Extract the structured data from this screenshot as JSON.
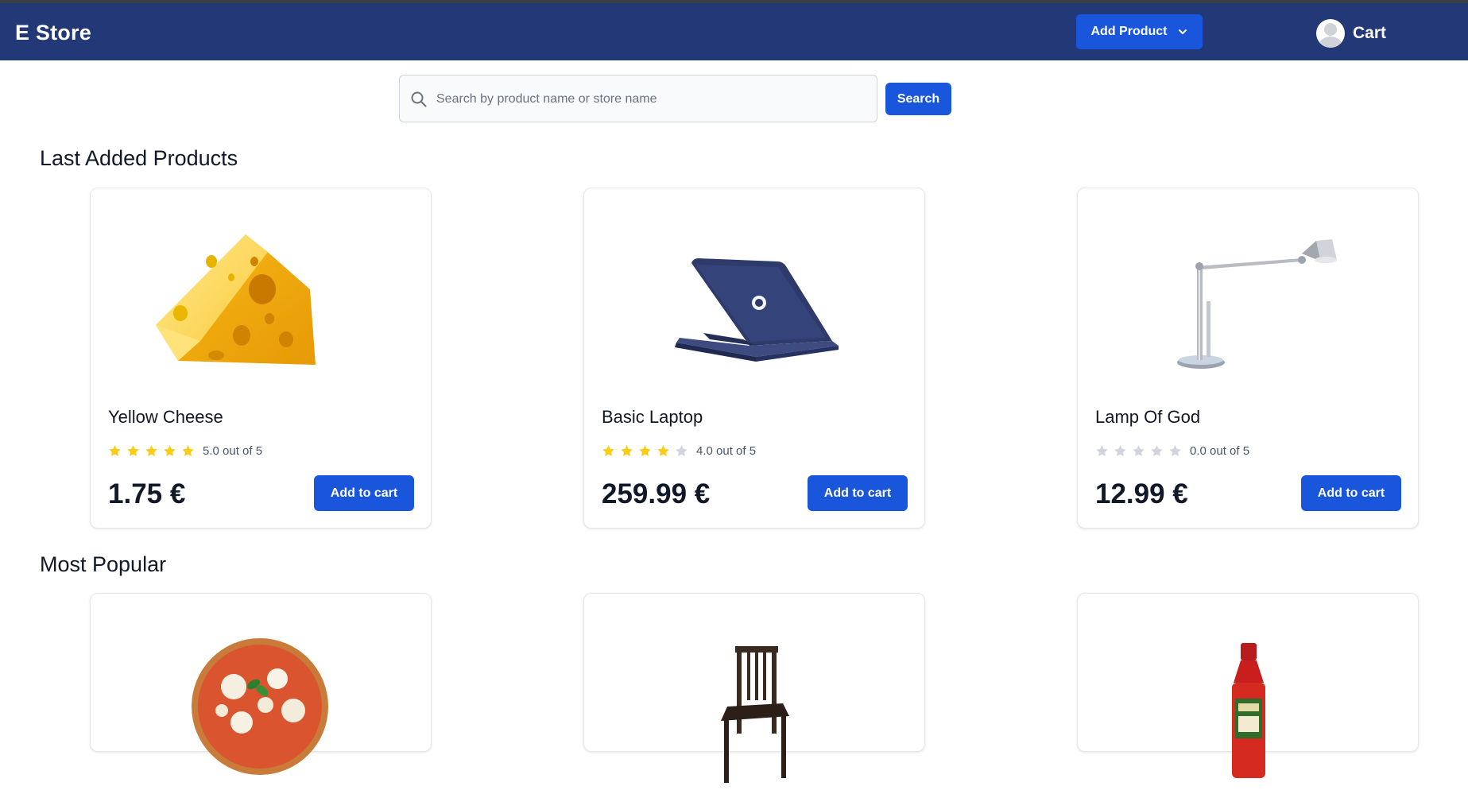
{
  "brand": "E Store",
  "navbar": {
    "add_product_label": "Add Product",
    "cart_label": "Cart"
  },
  "search": {
    "placeholder": "Search by product name or store name",
    "value": "",
    "button_label": "Search"
  },
  "sections": [
    {
      "title": "Last Added Products",
      "products": [
        {
          "name": "Yellow Cheese",
          "rating": 5,
          "rating_text": "5.0 out of 5",
          "price": "1.75 €",
          "button_label": "Add to cart",
          "image": "yellow-cheese-image"
        },
        {
          "name": "Basic Laptop",
          "rating": 4,
          "rating_text": "4.0 out of 5",
          "price": "259.99 €",
          "button_label": "Add to cart",
          "image": "laptop-image"
        },
        {
          "name": "Lamp Of God",
          "rating": 0,
          "rating_text": "0.0 out of 5",
          "price": "12.99 €",
          "button_label": "Add to cart",
          "image": "desk-lamp-image"
        }
      ]
    },
    {
      "title": "Most Popular",
      "products": [
        {
          "image": "pizza-image"
        },
        {
          "image": "chair-image"
        },
        {
          "image": "hot-sauce-image"
        }
      ]
    }
  ],
  "colors": {
    "navbar": "#233876",
    "primary": "#1a56db",
    "star_filled": "#facc15",
    "star_empty": "#d1d5db"
  }
}
